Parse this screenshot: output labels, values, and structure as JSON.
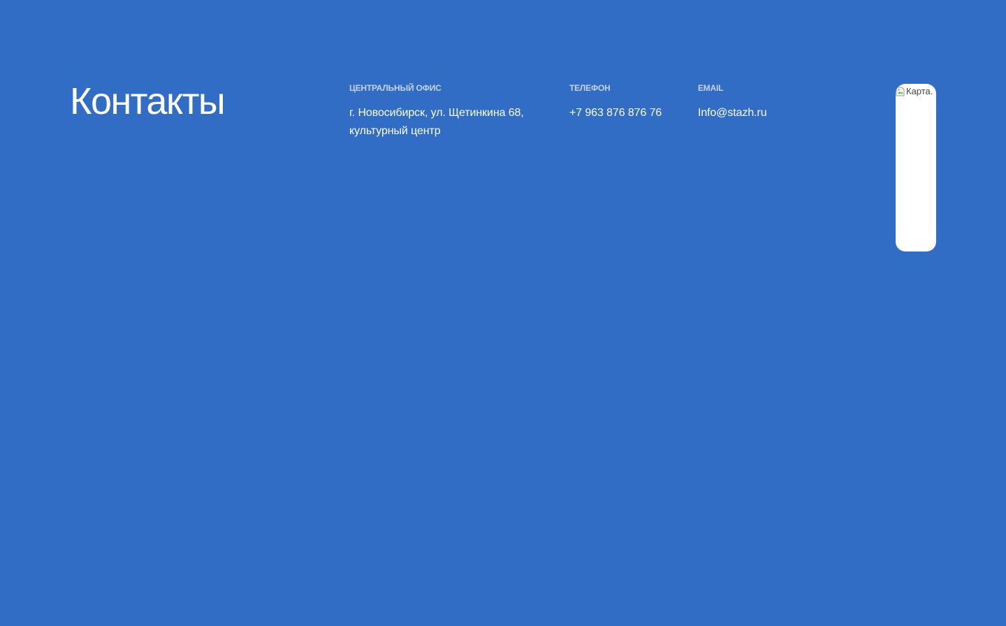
{
  "page": {
    "title": "Контакты"
  },
  "contacts": {
    "office": {
      "label": "Центральный офис",
      "value": "г. Новосибирск, ул. Щетинкина 68, культурный центр"
    },
    "phone": {
      "label": "Телефон",
      "value": "+7 963 876 876 76"
    },
    "email": {
      "label": "Email",
      "value": "Info@stazh.ru"
    }
  },
  "map": {
    "alt": "Карта.",
    "icon": "broken-image-icon"
  },
  "colors": {
    "background": "#316dc5",
    "text": "#ffffff",
    "label": "#c7d3ee",
    "map_background": "#ffffff"
  }
}
